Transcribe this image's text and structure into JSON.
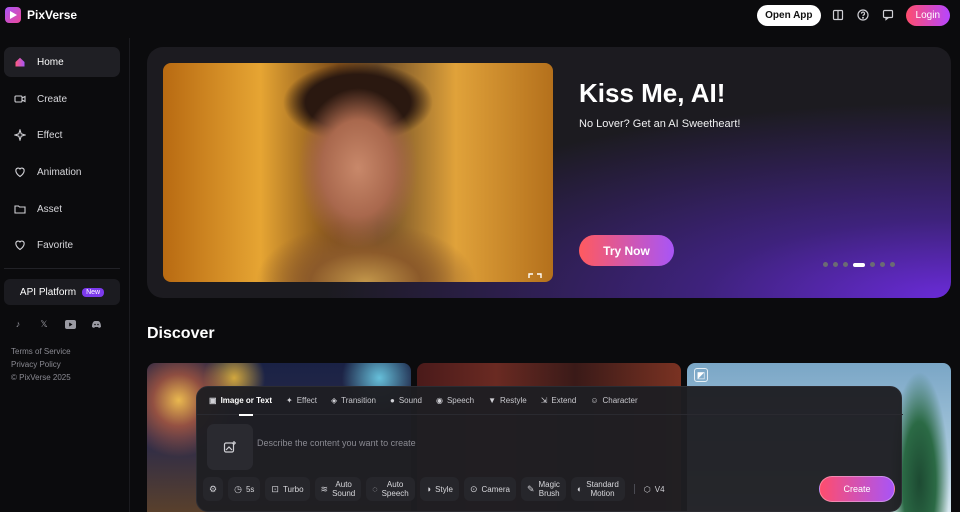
{
  "brand": {
    "name": "PixVerse"
  },
  "topbar": {
    "open_app": "Open App",
    "login": "Login"
  },
  "sidebar": {
    "items": [
      {
        "label": "Home",
        "icon": "home-icon"
      },
      {
        "label": "Create",
        "icon": "video-icon"
      },
      {
        "label": "Effect",
        "icon": "sparkle-icon"
      },
      {
        "label": "Animation",
        "icon": "heart-animation-icon"
      },
      {
        "label": "Asset",
        "icon": "folder-icon"
      },
      {
        "label": "Favorite",
        "icon": "heart-icon"
      }
    ],
    "api_platform": "API Platform",
    "api_badge": "New",
    "footer": {
      "terms": "Terms of Service",
      "privacy": "Privacy Policy",
      "copyright": "© PixVerse 2025"
    }
  },
  "hero": {
    "title": "Kiss Me, AI!",
    "subtitle": "No Lover? Get an AI Sweetheart!",
    "cta": "Try Now",
    "slide_count": 7,
    "active_slide": 4
  },
  "discover": {
    "heading": "Discover"
  },
  "panel": {
    "tabs": [
      {
        "label": "Image or Text",
        "icon": "image-icon"
      },
      {
        "label": "Effect",
        "icon": "sparkle-icon"
      },
      {
        "label": "Transition",
        "icon": "transition-icon"
      },
      {
        "label": "Sound",
        "icon": "sound-icon"
      },
      {
        "label": "Speech",
        "icon": "speech-icon"
      },
      {
        "label": "Restyle",
        "icon": "restyle-icon"
      },
      {
        "label": "Extend",
        "icon": "extend-icon"
      },
      {
        "label": "Character",
        "icon": "character-icon"
      }
    ],
    "prompt_placeholder": "Describe the content you want to create",
    "options": {
      "duration": "5s",
      "turbo": "Turbo",
      "auto_sound_1": "Auto",
      "auto_sound_2": "Sound",
      "auto_speech_1": "Auto",
      "auto_speech_2": "Speech",
      "style": "Style",
      "camera": "Camera",
      "magic_brush_1": "Magic",
      "magic_brush_2": "Brush",
      "standard_motion_1": "Standard",
      "standard_motion_2": "Motion"
    },
    "version": "V4",
    "create": "Create"
  }
}
